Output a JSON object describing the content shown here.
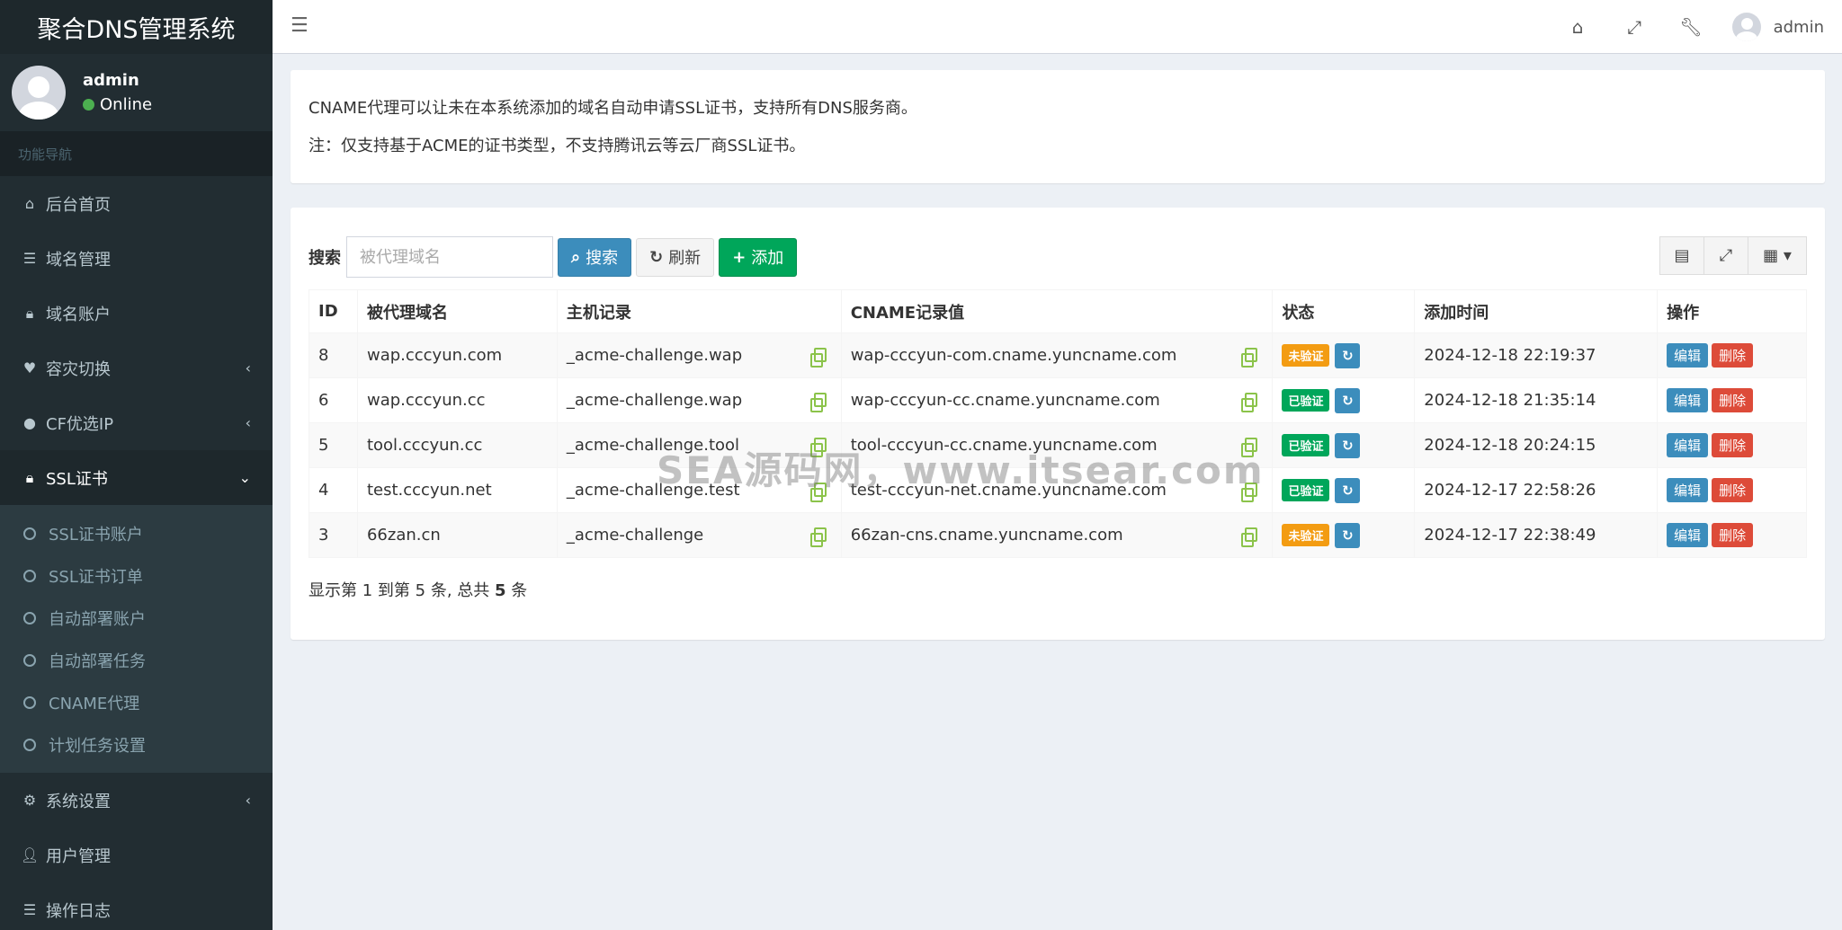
{
  "brand": "聚合DNS管理系统",
  "user": {
    "name": "admin",
    "status": "Online"
  },
  "nav_header": "功能导航",
  "nav": [
    {
      "label": "后台首页",
      "icon": "home-icon"
    },
    {
      "label": "域名管理",
      "icon": "list-icon"
    },
    {
      "label": "域名账户",
      "icon": "lock-icon"
    },
    {
      "label": "容灾切换",
      "icon": "heartbeat-icon"
    },
    {
      "label": "CF优选IP",
      "icon": "globe-icon"
    },
    {
      "label": "SSL证书",
      "icon": "ssl-lock-icon"
    },
    {
      "label": "系统设置",
      "icon": "gears-icon"
    },
    {
      "label": "用户管理",
      "icon": "user-icon"
    },
    {
      "label": "操作日志",
      "icon": "list-icon"
    }
  ],
  "ssl_sub": [
    "SSL证书账户",
    "SSL证书订单",
    "自动部署账户",
    "自动部署任务",
    "CNAME代理",
    "计划任务设置"
  ],
  "topbar": {
    "username": "admin"
  },
  "info": {
    "line1": "CNAME代理可以让未在本系统添加的域名自动申请SSL证书，支持所有DNS服务商。",
    "line2": "注：仅支持基于ACME的证书类型，不支持腾讯云等云厂商SSL证书。"
  },
  "toolbar": {
    "search_label": "搜索",
    "search_placeholder": "被代理域名",
    "search_btn": "搜索",
    "refresh_btn": "刷新",
    "add_btn": "添加"
  },
  "table": {
    "headers": [
      "ID",
      "被代理域名",
      "主机记录",
      "CNAME记录值",
      "状态",
      "添加时间",
      "操作"
    ],
    "rows": [
      {
        "id": "8",
        "domain": "wap.cccyun.com",
        "host": "_acme-challenge.wap",
        "cname": "wap-cccyun-com.cname.yuncname.com",
        "status": "未验证",
        "status_type": "warning",
        "time": "2024-12-18 22:19:37"
      },
      {
        "id": "6",
        "domain": "wap.cccyun.cc",
        "host": "_acme-challenge.wap",
        "cname": "wap-cccyun-cc.cname.yuncname.com",
        "status": "已验证",
        "status_type": "success",
        "time": "2024-12-18 21:35:14"
      },
      {
        "id": "5",
        "domain": "tool.cccyun.cc",
        "host": "_acme-challenge.tool",
        "cname": "tool-cccyun-cc.cname.yuncname.com",
        "status": "已验证",
        "status_type": "success",
        "time": "2024-12-18 20:24:15"
      },
      {
        "id": "4",
        "domain": "test.cccyun.net",
        "host": "_acme-challenge.test",
        "cname": "test-cccyun-net.cname.yuncname.com",
        "status": "已验证",
        "status_type": "success",
        "time": "2024-12-17 22:58:26"
      },
      {
        "id": "3",
        "domain": "66zan.cn",
        "host": "_acme-challenge",
        "cname": "66zan-cns.cname.yuncname.com",
        "status": "未验证",
        "status_type": "warning",
        "time": "2024-12-17 22:38:49"
      }
    ],
    "edit_label": "编辑",
    "delete_label": "删除"
  },
  "pager": {
    "prefix": "显示第",
    "from": "1",
    "mid1": "到第",
    "to": "5",
    "mid2": "条, 总共",
    "total": "5",
    "suffix": "条"
  },
  "watermark": "SEA源码网，www.itsear.com"
}
